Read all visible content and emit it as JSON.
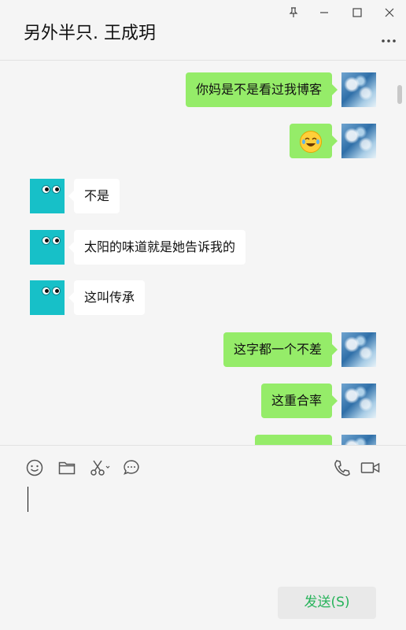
{
  "header": {
    "title": "另外半只. 王成玥",
    "window_controls": [
      "pin-icon",
      "minimize-icon",
      "maximize-icon",
      "close-icon"
    ]
  },
  "messages": [
    {
      "side": "right",
      "text": "你妈是不是看过我博客"
    },
    {
      "side": "right",
      "text": "",
      "emoji": "laughing-tears-emoji"
    },
    {
      "side": "left",
      "text": "不是"
    },
    {
      "side": "left",
      "text": "太阳的味道就是她告诉我的"
    },
    {
      "side": "left",
      "text": "这叫传承"
    },
    {
      "side": "right",
      "text": "这字都一个不差"
    },
    {
      "side": "right",
      "text": "这重合率"
    },
    {
      "side": "right",
      "text": ""
    }
  ],
  "toolbar": {
    "left_tools": [
      "emoji-icon",
      "folder-icon",
      "scissors-icon",
      "chat-history-icon"
    ],
    "right_tools": [
      "phone-icon",
      "video-icon"
    ]
  },
  "input": {
    "value": ""
  },
  "send_button": {
    "label": "发送(S)"
  },
  "colors": {
    "sent_bubble": "#95ec69",
    "received_bubble": "#ffffff",
    "send_text": "#27b35a",
    "avatar_teal": "#17c0c8"
  }
}
